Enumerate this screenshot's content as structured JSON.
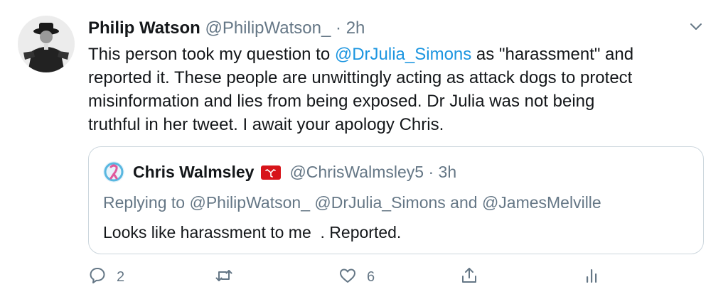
{
  "tweet": {
    "author_name": "Philip Watson",
    "author_handle": "@PhilipWatson_",
    "separator": "·",
    "time": "2h",
    "text_lines": [
      {
        "pre": "This person took my question to ",
        "mention": "@DrJulia_Simons",
        "post": " as \"harassment\" and"
      },
      {
        "text": "reported it.  These people are unwittingly acting as attack dogs to protect"
      },
      {
        "text": "misinformation and lies from being exposed.  Dr Julia was not being"
      },
      {
        "text": "truthful in her tweet. I await your apology Chris."
      }
    ]
  },
  "quoted_tweet": {
    "author_name": "Chris Walmsley",
    "author_handle": "@ChrisWalmsley5",
    "separator": "·",
    "time": "3h",
    "flag_icon": "isle-of-man-flag-icon",
    "reply_prefix": "Replying to ",
    "reply_handles": [
      "@PhilipWatson_",
      "@DrJulia_Simons"
    ],
    "reply_and": " and ",
    "reply_last": "@JamesMelville",
    "text": "Looks like harassment to me  . Reported."
  },
  "actions": {
    "reply_count": "2",
    "retweet_count": "",
    "like_count": "6"
  },
  "colors": {
    "link": "#1b95e0",
    "secondary": "#657786",
    "border": "#ccd6dd",
    "flag": "#d7141a"
  }
}
